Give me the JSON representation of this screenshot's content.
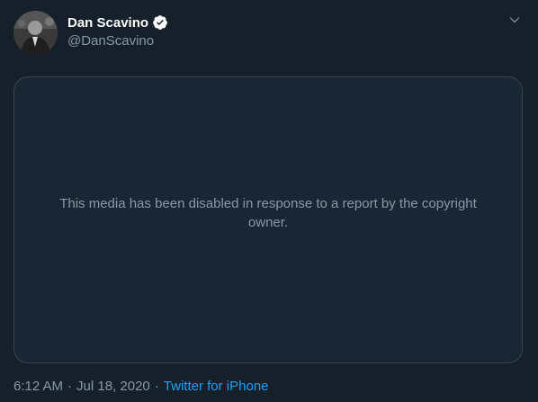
{
  "tweet": {
    "author": {
      "display_name": "Dan Scavino",
      "handle": "@DanScavino",
      "verified": true
    },
    "media": {
      "message": "This media has been disabled in response to a report by the copyright owner."
    },
    "meta": {
      "time": "6:12 AM",
      "separator": "·",
      "date": "Jul 18, 2020",
      "source": "Twitter for iPhone"
    },
    "icons": {
      "verified": "verified-badge-icon",
      "more": "chevron-down-icon"
    }
  },
  "colors": {
    "background": "#15202b",
    "media_background": "#192734",
    "border": "#38444d",
    "secondary_text": "#8899a6",
    "link": "#1da1f2"
  }
}
